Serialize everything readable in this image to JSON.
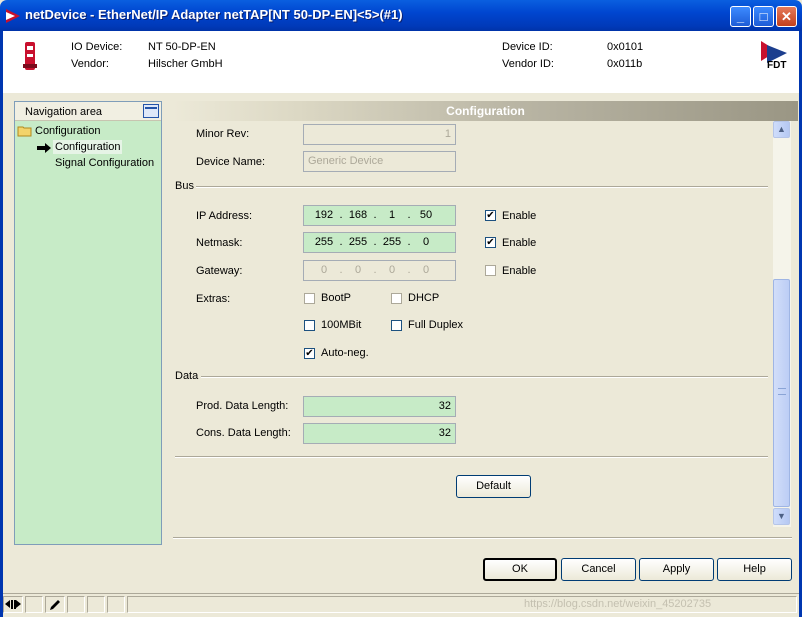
{
  "window": {
    "title": "netDevice - EtherNet/IP Adapter netTAP[NT 50-DP-EN]<5>(#1)",
    "min": "_",
    "max": "□",
    "close": "✕"
  },
  "header": {
    "io_device_label": "IO Device:",
    "io_device_value": "NT 50-DP-EN",
    "vendor_label": "Vendor:",
    "vendor_value": "Hilscher GmbH",
    "device_id_label": "Device ID:",
    "device_id_value": "0x0101",
    "vendor_id_label": "Vendor ID:",
    "vendor_id_value": "0x011b",
    "fdt_logo": "FDT"
  },
  "nav": {
    "title": "Navigation area",
    "root": "Configuration",
    "items": [
      {
        "label": "Configuration"
      },
      {
        "label": "Signal Configuration"
      }
    ]
  },
  "config": {
    "banner": "Configuration",
    "minor_rev_label": "Minor Rev:",
    "minor_rev_value": "1",
    "device_name_label": "Device Name:",
    "device_name_value": "Generic Device",
    "bus_group": "Bus",
    "ip_label": "IP Address:",
    "ip": [
      "192",
      "168",
      "1",
      "50"
    ],
    "netmask_label": "Netmask:",
    "netmask": [
      "255",
      "255",
      "255",
      "0"
    ],
    "gateway_label": "Gateway:",
    "gateway": [
      "0",
      "0",
      "0",
      "0"
    ],
    "enable_label": "Enable",
    "extras_label": "Extras:",
    "bootp": "BootP",
    "dhcp": "DHCP",
    "mbit100": "100MBit",
    "full_duplex": "Full Duplex",
    "auto_neg": "Auto-neg.",
    "data_group": "Data",
    "prod_label": "Prod. Data Length:",
    "prod_value": "32",
    "cons_label": "Cons. Data Length:",
    "cons_value": "32",
    "default_button": "Default",
    "check": "✔"
  },
  "footer": {
    "ok": "OK",
    "cancel": "Cancel",
    "apply": "Apply",
    "help": "Help"
  },
  "status": {
    "watermark": "https://blog.csdn.net/weixin_45202735"
  },
  "colors": {
    "field_green": "#c7ebc7",
    "titlebar_blue": "#0046d0"
  }
}
